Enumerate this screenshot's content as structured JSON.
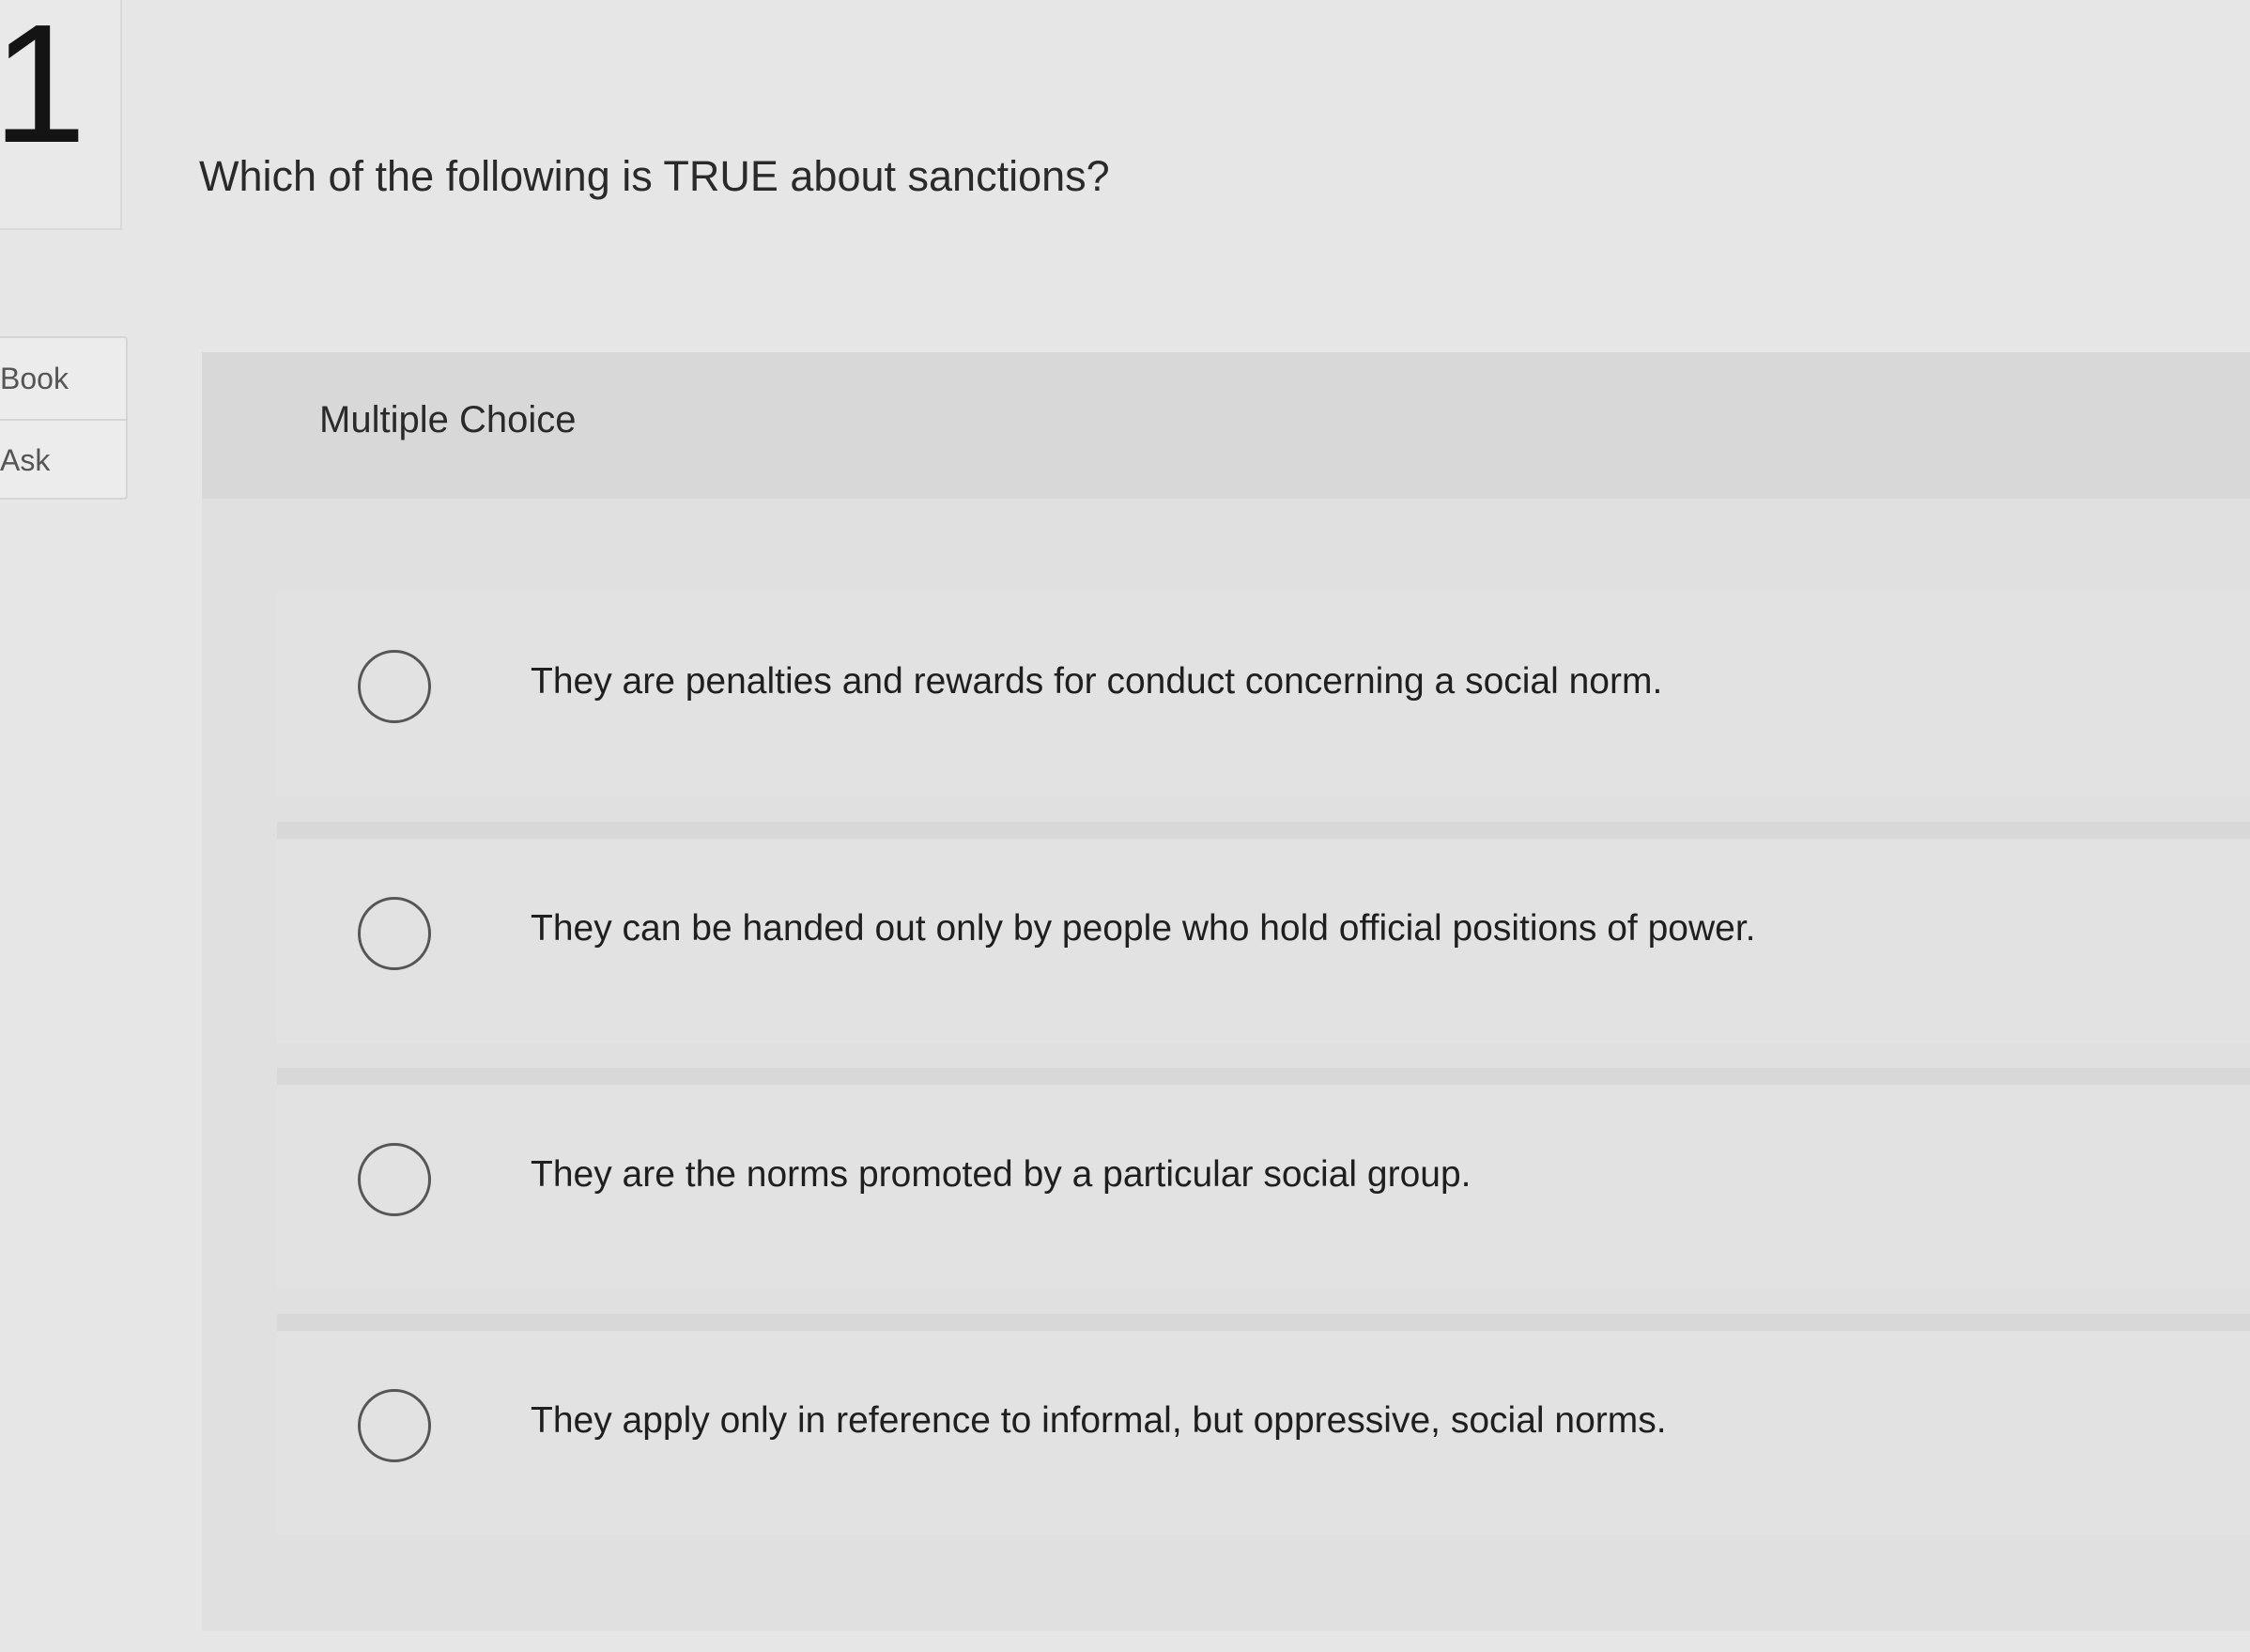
{
  "question": {
    "number": "1",
    "text": "Which of the following is TRUE about sanctions?"
  },
  "side_tools": [
    {
      "label": "Book"
    },
    {
      "label": "Ask"
    }
  ],
  "panel": {
    "title": "Multiple Choice"
  },
  "options": [
    {
      "label": "They are penalties and rewards for conduct concerning a social norm."
    },
    {
      "label": "They can be handed out only by people who hold official positions of power."
    },
    {
      "label": "They are the norms promoted by a particular social group."
    },
    {
      "label": "They apply only in reference to informal, but oppressive, social norms."
    }
  ]
}
